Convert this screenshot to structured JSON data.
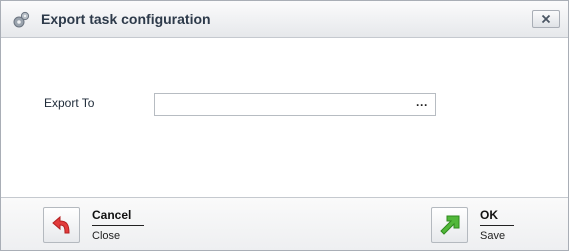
{
  "window": {
    "title": "Export task configuration",
    "title_icon": "gears-icon",
    "close_icon": "close-icon"
  },
  "form": {
    "export_to": {
      "label": "Export To",
      "value": "",
      "browse_label": "···"
    }
  },
  "footer": {
    "cancel": {
      "title": "Cancel",
      "subtitle": "Close",
      "icon": "undo-arrow-icon",
      "icon_color": "#e23b3b"
    },
    "ok": {
      "title": "OK",
      "subtitle": "Save",
      "icon": "diagonal-arrow-icon",
      "icon_color": "#52b83a"
    }
  }
}
